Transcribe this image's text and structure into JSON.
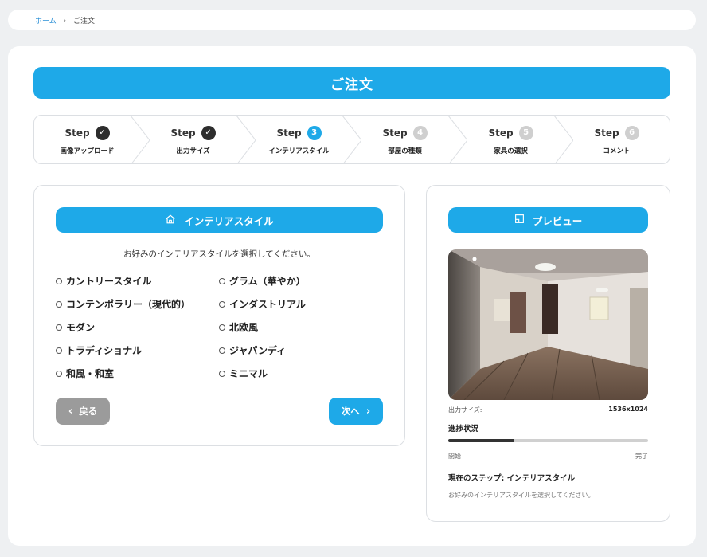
{
  "breadcrumb": {
    "home": "ホーム",
    "separator": "›",
    "current": "ご注文"
  },
  "page": {
    "title": "ご注文"
  },
  "steps": [
    {
      "word": "Step",
      "badge": "✓",
      "label": "画像アップロード",
      "state": "done"
    },
    {
      "word": "Step",
      "badge": "✓",
      "label": "出力サイズ",
      "state": "done"
    },
    {
      "word": "Step",
      "badge": "3",
      "label": "インテリアスタイル",
      "state": "active"
    },
    {
      "word": "Step",
      "badge": "4",
      "label": "部屋の種類",
      "state": "todo"
    },
    {
      "word": "Step",
      "badge": "5",
      "label": "家具の選択",
      "state": "todo"
    },
    {
      "word": "Step",
      "badge": "6",
      "label": "コメント",
      "state": "todo"
    }
  ],
  "style_panel": {
    "header": "インテリアスタイル",
    "icon": "home-icon",
    "instruction": "お好みのインテリアスタイルを選択してください。",
    "options": [
      "カントリースタイル",
      "グラム（華やか）",
      "コンテンポラリー（現代的）",
      "インダストリアル",
      "モダン",
      "北欧風",
      "トラディショナル",
      "ジャパンディ",
      "和風・和室",
      "ミニマル"
    ],
    "back_label": "戻る",
    "next_label": "次へ"
  },
  "preview_panel": {
    "header": "プレビュー",
    "icon": "preview-icon",
    "size_label": "出力サイズ:",
    "size_value": "1536x1024",
    "progress_title": "進捗状況",
    "progress_fraction": 0.33,
    "progress_start": "開始",
    "progress_end": "完了",
    "current_step": "現在のステップ: インテリアスタイル",
    "current_desc": "お好みのインテリアスタイルを選択してください。"
  },
  "colors": {
    "accent": "#1ea9e8",
    "done": "#2d2d2d",
    "todo": "#cfcfcf",
    "back_button": "#9b9b9b"
  }
}
